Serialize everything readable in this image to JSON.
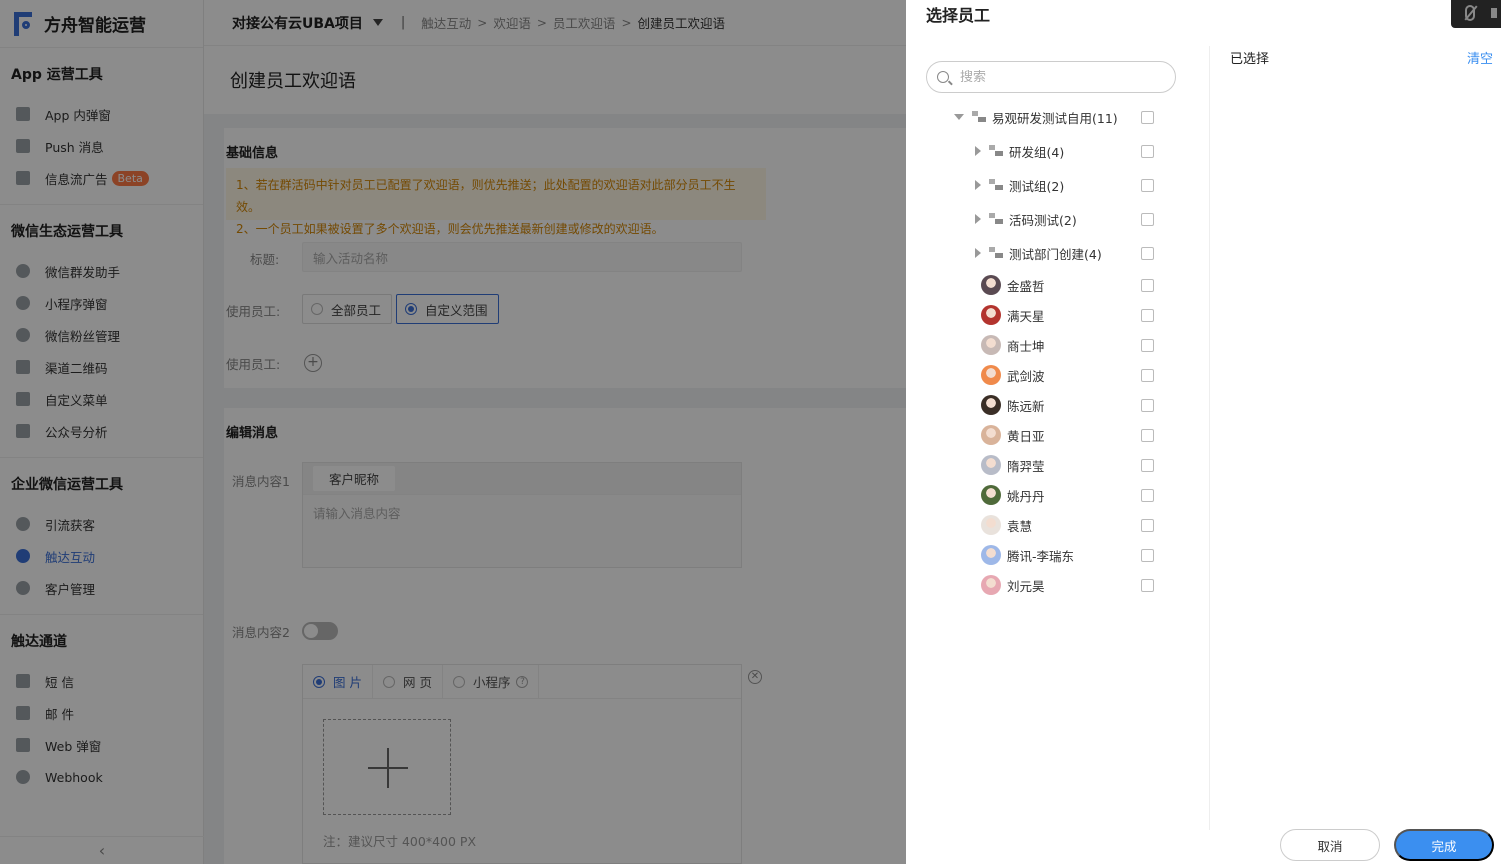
{
  "brand": {
    "name": "方舟智能运营"
  },
  "sidebar": {
    "sections": [
      {
        "title": "App 运营工具",
        "items": [
          "App 内弹窗",
          "Push 消息",
          "信息流广告"
        ]
      },
      {
        "title": "微信生态运营工具",
        "items": [
          "微信群发助手",
          "小程序弹窗",
          "微信粉丝管理",
          "渠道二维码",
          "自定义菜单",
          "公众号分析"
        ]
      },
      {
        "title": "企业微信运营工具",
        "items": [
          "引流获客",
          "触达互动",
          "客户管理"
        ]
      },
      {
        "title": "触达通道",
        "items": [
          "短 信",
          "邮 件",
          "Web 弹窗",
          "Webhook"
        ]
      }
    ],
    "beta_badge": "Beta",
    "collapse_icon": "‹"
  },
  "header": {
    "project": "对接公有云UBA项目",
    "separator": "|",
    "breadcrumb": [
      "触达互动",
      "欢迎语",
      "员工欢迎语",
      "创建员工欢迎语"
    ]
  },
  "main": {
    "page_title": "创建员工欢迎语",
    "basic": {
      "heading": "基础信息",
      "notices": [
        "1、若在群活码中针对员工已配置了欢迎语，则优先推送；此处配置的欢迎语对此部分员工不生效。",
        "2、一个员工如果被设置了多个欢迎语，则会优先推送最新创建或修改的欢迎语。"
      ],
      "title_label": "标题:",
      "title_placeholder": "输入活动名称",
      "staff_label": "使用员工:",
      "staff_all": "全部员工",
      "staff_custom": "自定义范围",
      "staff_label2": "使用员工:"
    },
    "message": {
      "heading": "编辑消息",
      "content1_label": "消息内容1",
      "nickname_btn": "客户昵称",
      "content_placeholder": "请输入消息内容",
      "content2_label": "消息内容2",
      "tabs": [
        "图 片",
        "网 页",
        "小程序"
      ],
      "upload_note": "注：建议尺寸 400*400 PX"
    }
  },
  "drawer": {
    "title": "选择员工",
    "search_placeholder": "搜索",
    "selected_title": "已选择",
    "clear": "清空",
    "root": {
      "label": "易观研发测试自用(11)"
    },
    "groups": [
      "研发组(4)",
      "测试组(2)",
      "活码测试(2)",
      "测试部门创建(4)"
    ],
    "staff": [
      {
        "name": "金盛哲",
        "color": "#5a4a52"
      },
      {
        "name": "满天星",
        "color": "#b3342e"
      },
      {
        "name": "商士坤",
        "color": "#c7b9b5"
      },
      {
        "name": "武剑波",
        "color": "#f08a4b"
      },
      {
        "name": "陈远新",
        "color": "#3a2e26"
      },
      {
        "name": "黄日亚",
        "color": "#d9b39a"
      },
      {
        "name": "隋羿莹",
        "color": "#b8bcc8"
      },
      {
        "name": "姚丹丹",
        "color": "#4f6a3a"
      },
      {
        "name": "袁慧",
        "color": "#e9e2dc"
      },
      {
        "name": "腾讯-李瑞东",
        "color": "#9eb8e8"
      },
      {
        "name": "刘元昊",
        "color": "#e7a8b2"
      }
    ],
    "cancel": "取消",
    "confirm": "完成"
  }
}
